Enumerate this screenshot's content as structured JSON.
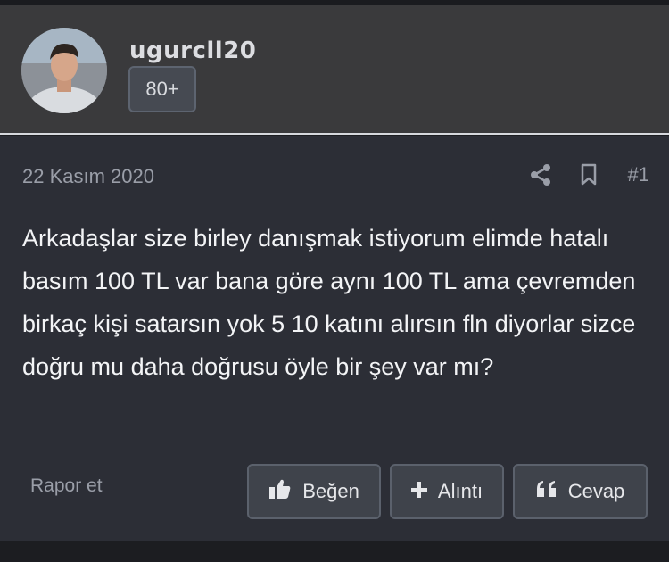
{
  "user": {
    "username": "ugurcll20",
    "badge": "80+"
  },
  "post": {
    "date": "22 Kasım 2020",
    "number": "#1",
    "body": "Arkadaşlar size birley danışmak istiyorum elimde hatalı basım 100 TL var bana göre aynı 100 TL ama çevremden birkaç kişi satarsın yok 5 10 katını alırsın fln diyorlar sizce doğru mu daha doğrusu öyle bir şey var mı?",
    "report_label": "Rapor et",
    "like_label": "Beğen",
    "quote_label": "Alıntı",
    "reply_label": "Cevap"
  },
  "icons": {
    "share": "share-icon",
    "bookmark": "bookmark-icon",
    "like": "thumbs-up-icon",
    "quote": "plus-icon",
    "reply": "quote-marks-icon"
  },
  "colors": {
    "header_bg": "#3a3a3c",
    "post_bg": "#2c2e36",
    "muted_text": "#9a9ea8",
    "button_bg": "#3f434b"
  }
}
